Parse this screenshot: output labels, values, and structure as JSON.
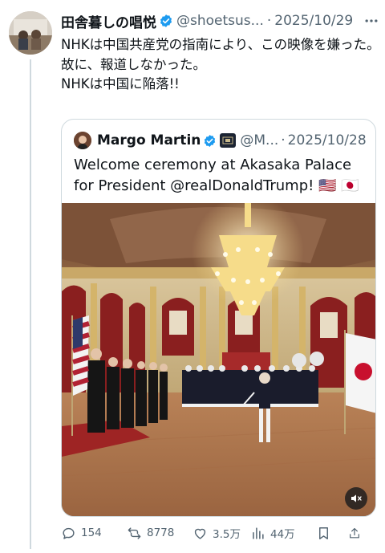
{
  "tweet": {
    "author_name": "田舎暮しの唱悦",
    "handle": "@shoetsus...",
    "separator": "·",
    "date": "2025/10/29",
    "lines": [
      "NHKは中国共産党の指南により、この映像を嫌った。",
      "故に、報道しなかった。",
      "NHKは中国に陥落!!"
    ]
  },
  "quote": {
    "author_name": "Margo Martin",
    "handle": "@M...",
    "separator": "·",
    "date": "2025/10/28",
    "text": "Welcome ceremony at Akasaka Palace for President @realDonaldTrump! 🇺🇸 🇯🇵",
    "media": {
      "type": "video",
      "muted": true
    }
  },
  "actions": {
    "replies": "154",
    "reposts": "8778",
    "likes": "3.5万",
    "views": "44万"
  },
  "icons": {
    "verified": "verified-badge-icon",
    "more": "more-icon",
    "reply": "reply-icon",
    "repost": "repost-icon",
    "like": "heart-icon",
    "views": "views-icon",
    "bookmark": "bookmark-icon",
    "share": "share-icon",
    "mute": "mute-icon"
  },
  "colors": {
    "text": "#0f1419",
    "secondary": "#536471",
    "verified": "#1d9bf0",
    "border": "#cfd9de"
  }
}
